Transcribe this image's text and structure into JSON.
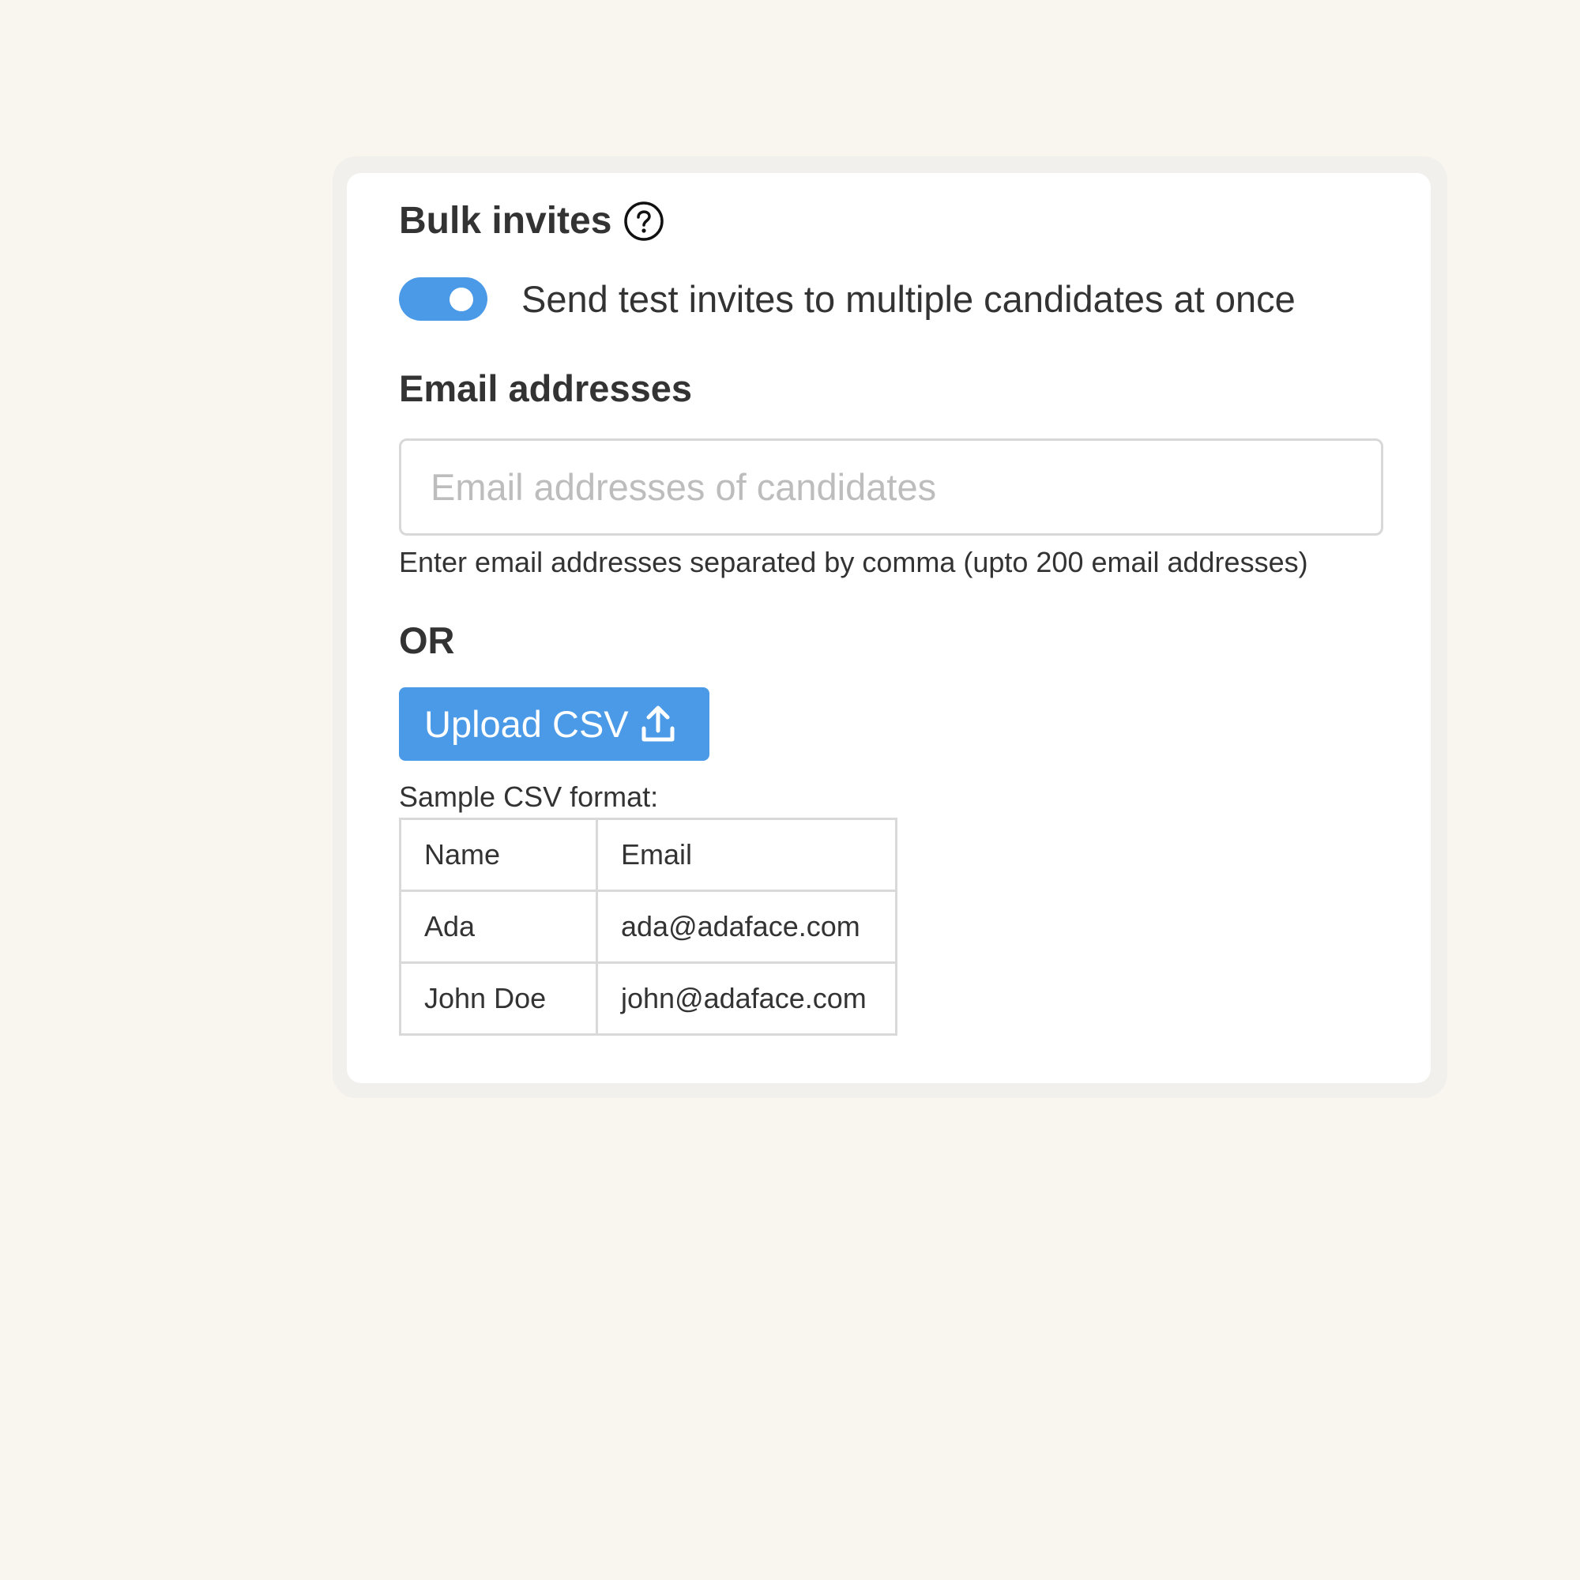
{
  "panel": {
    "title": "Bulk invites",
    "help_icon": "question-circle-icon",
    "toggle": {
      "state": "on",
      "label": "Send test invites to multiple candidates at once"
    },
    "email_section": {
      "label": "Email addresses",
      "input_value": "",
      "placeholder": "Email addresses of candidates",
      "hint": "Enter email addresses separated by comma (upto 200 email addresses)"
    },
    "or_text": "OR",
    "upload_button": {
      "label": "Upload CSV",
      "icon": "upload-icon"
    },
    "sample": {
      "label": "Sample CSV format:",
      "headers": [
        "Name",
        "Email"
      ],
      "rows": [
        [
          "Ada",
          "ada@adaface.com"
        ],
        [
          "John Doe",
          "john@adaface.com"
        ]
      ]
    }
  },
  "colors": {
    "accent": "#4a9ae8",
    "page_background": "#f9f5ef",
    "card_background": "#ffffff",
    "text": "#333333",
    "border": "#d9d9d9"
  }
}
